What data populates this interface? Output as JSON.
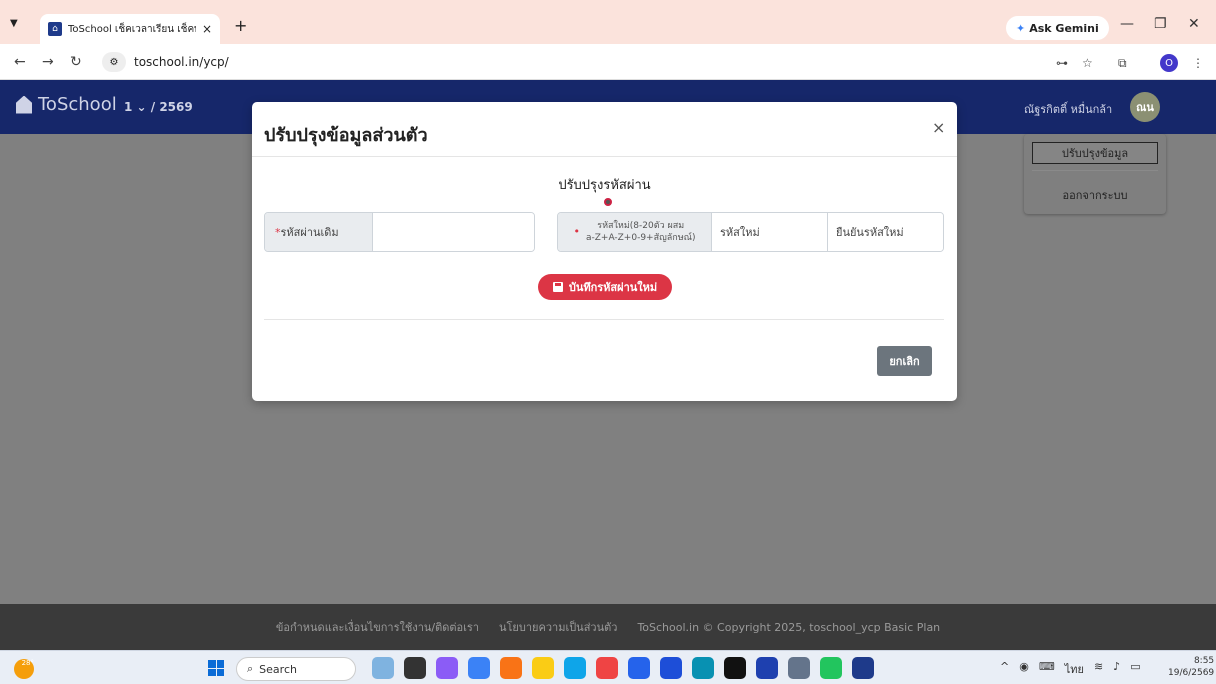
{
  "browser": {
    "tab_title": "ToSchool เช็คเวลาเรียน เช็คพฤติกร",
    "tab_close": "×",
    "new_tab": "+",
    "url": "toschool.in/ycp/",
    "gemini_label": "Ask Gemini",
    "profile_initial": "O"
  },
  "app": {
    "brand": "ToSchool",
    "term": "1 ⌄ / 2569",
    "user_name": "ณัฐรกิตติ์ หมื่นกล้า",
    "avatar_initials": "ณน",
    "dropdown": {
      "update_profile": "ปรับปรุงข้อมูล",
      "logout": "ออกจากระบบ"
    }
  },
  "modal": {
    "title": "ปรับปรุงข้อมูลส่วนตัว",
    "close": "×",
    "section_title": "ปรับปรุงรหัสผ่าน",
    "old_password_label": "รหัสผ่านเดิม",
    "old_password_value": "",
    "new_password_hint_1": "รหัสใหม่(8-20ตัว ผสม",
    "new_password_hint_2": "a-Z+A-Z+0-9+สัญลักษณ์)",
    "new_password_placeholder": "รหัสใหม่",
    "confirm_password_placeholder": "ยืนยันรหัสใหม่",
    "save_button": "บันทึกรหัสผ่านใหม่",
    "cancel_button": "ยกเลิก"
  },
  "footer": {
    "terms": "ข้อกำหนดและเงื่อนไขการใช้งาน/ติดต่อเรา",
    "privacy": "นโยบายความเป็นส่วนตัว",
    "copyright": "ToSchool.in © Copyright 2025, toschool_ycp Basic Plan"
  },
  "taskbar": {
    "weather": "28°",
    "search_label": "Search",
    "lang": "ไทย",
    "time": "8:55",
    "date": "19/6/2569"
  },
  "colors": {
    "navbar": "#16276a",
    "danger": "#dc3545",
    "secondary": "#6c757d",
    "footer": "#3a3a3a"
  }
}
